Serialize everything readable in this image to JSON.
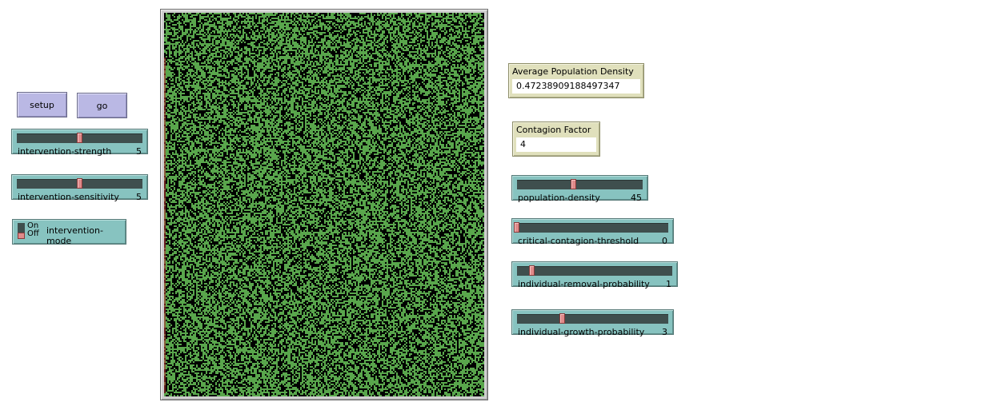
{
  "buttons": {
    "setup": "setup",
    "go": "go"
  },
  "sliders": {
    "intervention_strength": {
      "label": "intervention-strength",
      "value": "5",
      "fraction": 0.5
    },
    "intervention_sensitivity": {
      "label": "intervention-sensitivity",
      "value": "5",
      "fraction": 0.5
    },
    "population_density": {
      "label": "population-density",
      "value": "45",
      "fraction": 0.45
    },
    "critical_contagion_threshold": {
      "label": "critical-contagion-threshold",
      "value": "0",
      "fraction": 0.0
    },
    "individual_removal_probability": {
      "label": "individual-removal-probability",
      "value": "1",
      "fraction": 0.1
    },
    "individual_growth_probability": {
      "label": "individual-growth-probability",
      "value": "3",
      "fraction": 0.3
    }
  },
  "switch": {
    "label": "intervention-mode",
    "on": "On",
    "off": "Off",
    "state": "off"
  },
  "monitors": {
    "average_population_density": {
      "label": "Average Population Density",
      "value": "0.47238909188497347"
    },
    "contagion_factor": {
      "label": "Contagion Factor",
      "value": "4"
    }
  },
  "world": {
    "live_color": "#59a64c",
    "dead_color": "#000000",
    "density": 0.47238909188497347
  }
}
